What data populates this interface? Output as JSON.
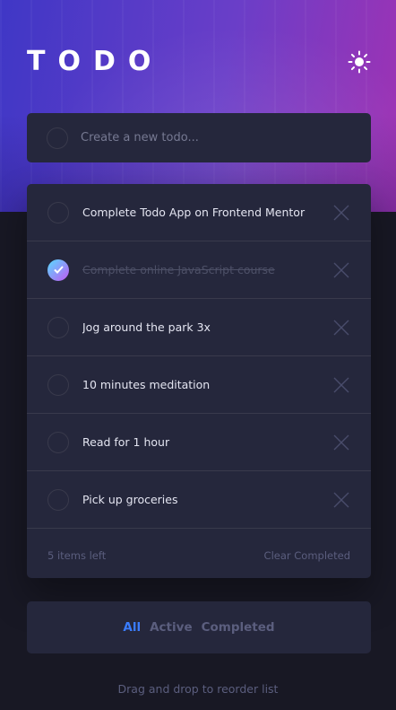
{
  "header": {
    "title": "TODO",
    "theme_icon": "sun-icon"
  },
  "new_todo": {
    "placeholder": "Create a new todo..."
  },
  "todos": [
    {
      "text": "Complete Todo App on Frontend Mentor",
      "completed": false
    },
    {
      "text": "Complete online JavaScript course",
      "completed": true
    },
    {
      "text": "Jog around the park 3x",
      "completed": false
    },
    {
      "text": "10 minutes meditation",
      "completed": false
    },
    {
      "text": "Read for 1 hour",
      "completed": false
    },
    {
      "text": "Pick up groceries",
      "completed": false
    }
  ],
  "footer": {
    "items_left": "5 items left",
    "clear_label": "Clear Completed"
  },
  "filters": {
    "all": "All",
    "active": "Active",
    "completed": "Completed",
    "selected": "All"
  },
  "hint": "Drag and drop to reorder list",
  "colors": {
    "accent": "#3a7cfd",
    "card": "#25273c",
    "background": "#181824",
    "check_gradient_start": "#57ddff",
    "check_gradient_end": "#c058f3"
  }
}
